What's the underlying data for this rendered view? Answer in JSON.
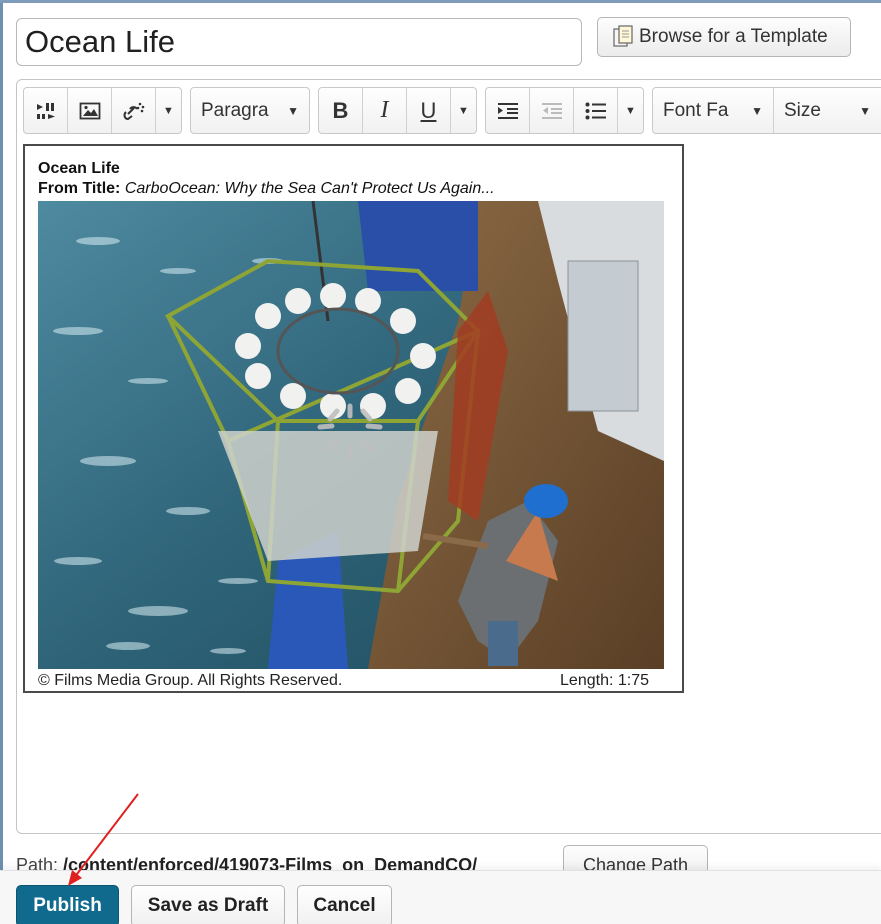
{
  "title_field": {
    "value": "Ocean Life"
  },
  "browse_button": {
    "label": "Browse for a Template"
  },
  "toolbar": {
    "paragraph_dropdown": "Paragra",
    "bold": "B",
    "italic": "I",
    "underline": "U",
    "font_family_dropdown": "Font Fa",
    "size_dropdown": "Size"
  },
  "media": {
    "title": "Ocean Life",
    "from_label": "From Title:",
    "from_value": "CarboOcean: Why the Sea Can't Protect Us Again...",
    "copyright": "© Films Media Group. All Rights Reserved.",
    "length": "Length: 1:75"
  },
  "path": {
    "label": "Path:",
    "value": "/content/enforced/419073-Films_on_DemandCO/"
  },
  "change_path_button": {
    "label": "Change Path"
  },
  "actions": {
    "publish": "Publish",
    "save_draft": "Save as Draft",
    "cancel": "Cancel"
  },
  "colors": {
    "primary_button": "#0f6a8e",
    "annotation_arrow": "#e02020"
  }
}
